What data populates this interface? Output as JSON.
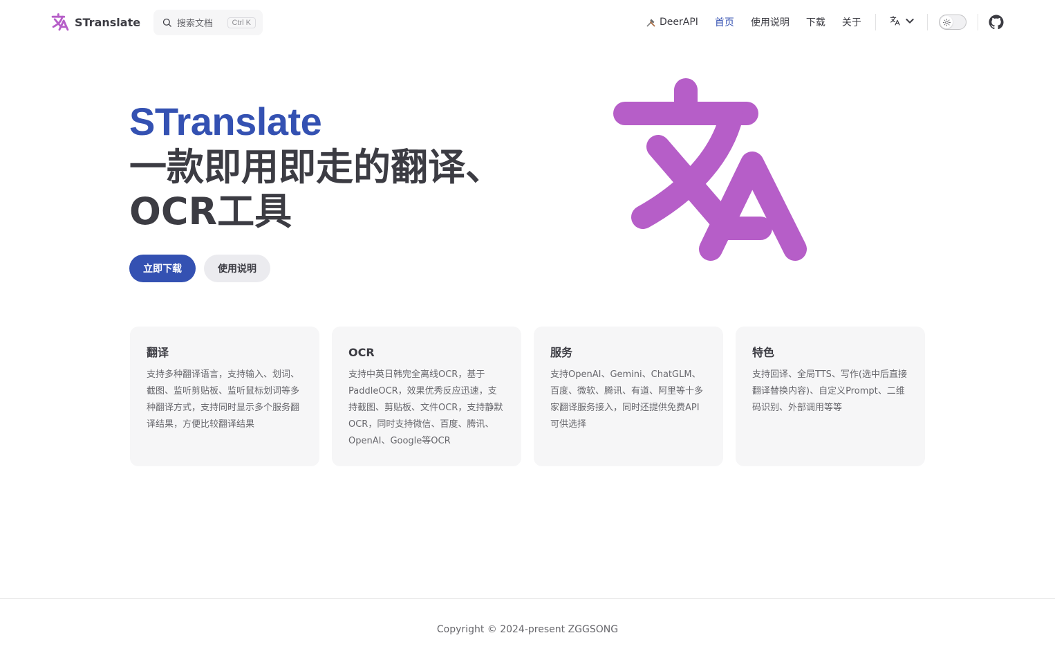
{
  "nav": {
    "brand_title": "STranslate",
    "search_placeholder": "搜索文档",
    "search_shortcut": "Ctrl K",
    "links": [
      {
        "label": "DeerAPI",
        "active": false
      },
      {
        "label": "首页",
        "active": true
      },
      {
        "label": "使用说明",
        "active": false
      },
      {
        "label": "下载",
        "active": false
      },
      {
        "label": "关于",
        "active": false
      }
    ],
    "icons": [
      "translate-logo-icon",
      "search-icon",
      "tools-icon",
      "language-icon",
      "chevron-down-icon",
      "sun-icon",
      "github-icon"
    ]
  },
  "hero": {
    "name": "STranslate",
    "text": "一款即用即走的翻译、OCR工具",
    "actions": [
      {
        "label": "立即下载",
        "theme": "brand"
      },
      {
        "label": "使用说明",
        "theme": "alt"
      }
    ]
  },
  "features": [
    {
      "title": "翻译",
      "details": "支持多种翻译语言，支持输入、划词、截图、监听剪贴板、监听鼠标划词等多种翻译方式，支持同时显示多个服务翻译结果，方便比较翻译结果"
    },
    {
      "title": "OCR",
      "details": "支持中英日韩完全离线OCR，基于PaddleOCR，效果优秀反应迅速，支持截图、剪贴板、文件OCR，支持静默OCR，同时支持微信、百度、腾讯、OpenAI、Google等OCR"
    },
    {
      "title": "服务",
      "details": "支持OpenAI、Gemini、ChatGLM、百度、微软、腾讯、有道、阿里等十多家翻译服务接入，同时还提供免费API可供选择"
    },
    {
      "title": "特色",
      "details": "支持回译、全局TTS、写作(选中后直接翻译替换内容)、自定义Prompt、二维码识别、外部调用等等"
    }
  ],
  "footer": {
    "copyright": "Copyright © 2024-present ZGGSONG"
  },
  "colors": {
    "brand": "#3451b2",
    "logo": "#b65ec8",
    "text": "#3c3c43",
    "muted": "#67676c"
  }
}
